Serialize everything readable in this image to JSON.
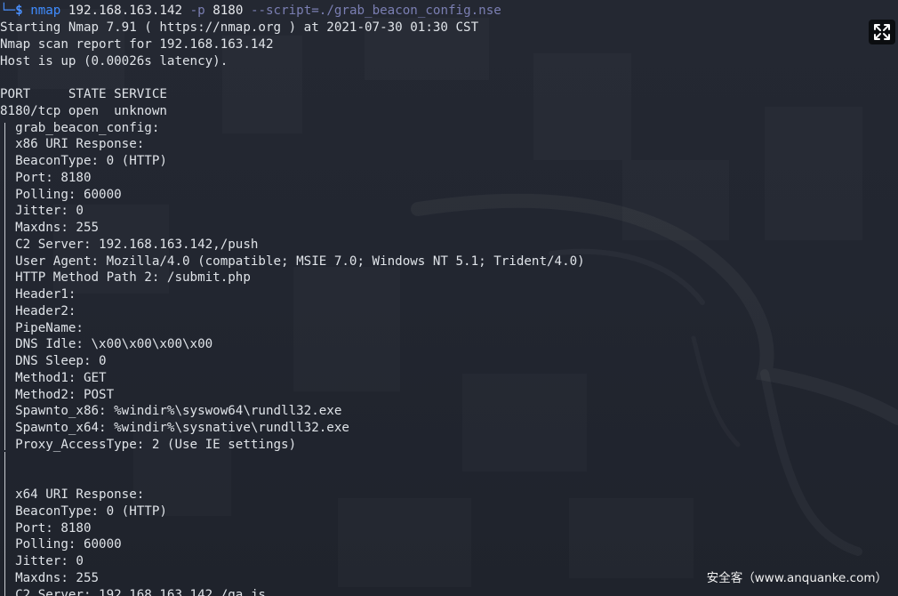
{
  "terminal": {
    "command": {
      "prefix": "└─",
      "prompt": "$",
      "program": "nmap",
      "target": "192.168.163.142",
      "flag": "-p",
      "port": "8180",
      "script": "--script=./grab_beacon_config.nse"
    },
    "lines": [
      "Starting Nmap 7.91 ( https://nmap.org ) at 2021-07-30 01:30 CST",
      "Nmap scan report for 192.168.163.142",
      "Host is up (0.00026s latency).",
      "",
      "PORT     STATE SERVICE",
      "8180/tcp open  unknown",
      "  grab_beacon_config:",
      "  x86 URI Response:",
      "  BeaconType: 0 (HTTP)",
      "  Port: 8180",
      "  Polling: 60000",
      "  Jitter: 0",
      "  Maxdns: 255",
      "  C2 Server: 192.168.163.142,/push",
      "  User Agent: Mozilla/4.0 (compatible; MSIE 7.0; Windows NT 5.1; Trident/4.0)",
      "  HTTP Method Path 2: /submit.php",
      "  Header1:",
      "  Header2:",
      "  PipeName:",
      "  DNS Idle: \\x00\\x00\\x00\\x00",
      "  DNS Sleep: 0",
      "  Method1: GET",
      "  Method2: POST",
      "  Spawnto_x86: %windir%\\syswow64\\rundll32.exe",
      "  Spawnto_x64: %windir%\\sysnative\\rundll32.exe",
      "  Proxy_AccessType: 2 (Use IE settings)",
      "",
      "",
      "  x64 URI Response:",
      "  BeaconType: 0 (HTTP)",
      "  Port: 8180",
      "  Polling: 60000",
      "  Jitter: 0",
      "  Maxdns: 255",
      "  C2 Server: 192.168.163.142,/ga.js"
    ]
  },
  "expand_button": {
    "icon": "expand-icon"
  },
  "watermark": "安全客（www.anquanke.com）",
  "colors": {
    "background": "#222630",
    "text": "#dfe3e8",
    "prompt": "#4a90ff",
    "flag": "#7b7fb3"
  }
}
